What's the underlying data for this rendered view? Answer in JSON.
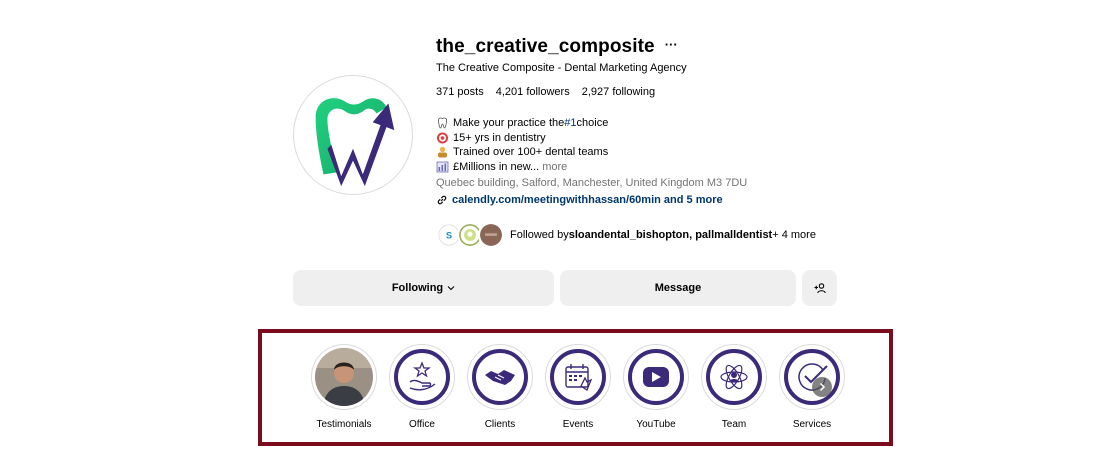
{
  "profile": {
    "username": "the_creative_composite",
    "more_icon": "ellipsis-icon",
    "full_name": "The Creative Composite - Dental Marketing Agency",
    "stats": {
      "posts": "371",
      "posts_label": "posts",
      "followers": "4,201",
      "followers_label": "followers",
      "following": "2,927",
      "following_label": "following"
    },
    "bio": {
      "line1_pre": "Make your practice the ",
      "line1_hash": "#1",
      "line1_post": " choice",
      "line2": "15+ yrs in dentistry",
      "line3": "Trained over 100+ dental teams",
      "line4": "£Millions in new...",
      "more": "more",
      "emojis": [
        "tooth-icon",
        "target-icon",
        "teacher-icon",
        "chart-icon"
      ]
    },
    "location": "Quebec building, Salford, Manchester, United Kingdom M3 7DU",
    "link": "calendly.com/meetingwithhassan/60min and 5 more",
    "followed_by": {
      "prefix": "Followed by ",
      "names": "sloandental_bishopton, pallmalldentist",
      "suffix": " + 4 more"
    }
  },
  "actions": {
    "following": "Following",
    "message": "Message",
    "add_icon": "person-add-icon"
  },
  "highlights": [
    {
      "label": "Testimonials",
      "icon": "person-photo"
    },
    {
      "label": "Office",
      "icon": "hand-star-icon"
    },
    {
      "label": "Clients",
      "icon": "handshake-icon"
    },
    {
      "label": "Events",
      "icon": "calendar-icon"
    },
    {
      "label": "YouTube",
      "icon": "youtube-icon"
    },
    {
      "label": "Team",
      "icon": "team-icon"
    },
    {
      "label": "Services",
      "icon": "check-badge-icon"
    }
  ],
  "colors": {
    "brand_green": "#1fc07a",
    "brand_purple": "#3b2a7a",
    "highlight_frame": "#7a0c1e",
    "link_blue": "#00376b"
  }
}
